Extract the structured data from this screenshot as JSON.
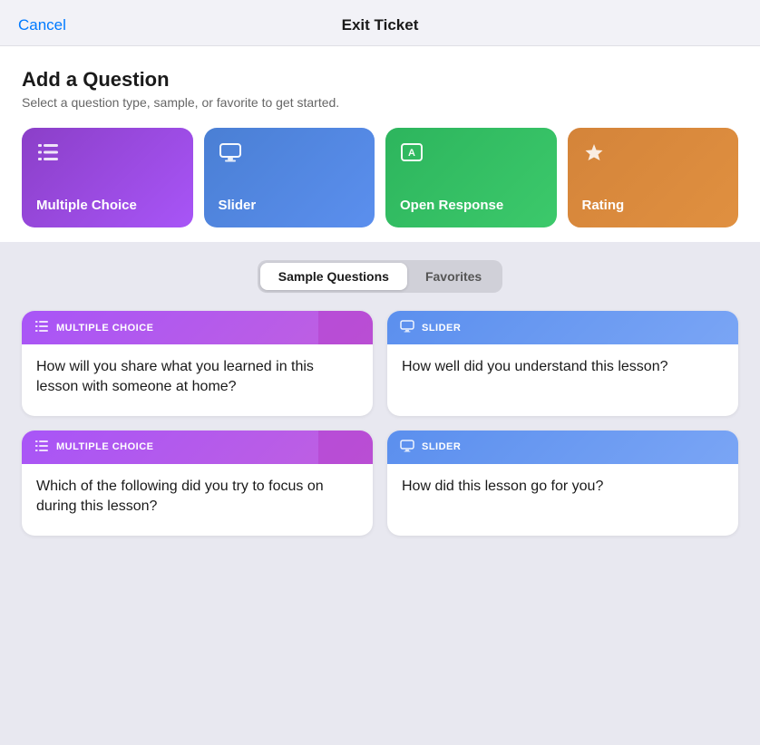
{
  "header": {
    "cancel_label": "Cancel",
    "title": "Exit Ticket"
  },
  "add_question": {
    "title": "Add a Question",
    "subtitle": "Select a question type, sample, or favorite to get started."
  },
  "type_cards": [
    {
      "id": "multiple-choice",
      "label": "Multiple Choice",
      "color": "purple",
      "icon": "list-icon"
    },
    {
      "id": "slider",
      "label": "Slider",
      "color": "blue",
      "icon": "monitor-icon"
    },
    {
      "id": "open-response",
      "label": "Open Response",
      "color": "green",
      "icon": "textbox-icon"
    },
    {
      "id": "rating",
      "label": "Rating",
      "color": "orange",
      "icon": "star-icon"
    }
  ],
  "tabs": [
    {
      "id": "sample",
      "label": "Sample Questions",
      "active": true
    },
    {
      "id": "favorites",
      "label": "Favorites",
      "active": false
    }
  ],
  "question_cards": [
    {
      "id": "q1",
      "type": "mc",
      "type_label": "MULTIPLE CHOICE",
      "question": "How will you share what you learned in this lesson with someone at home?"
    },
    {
      "id": "q2",
      "type": "sl",
      "type_label": "SLIDER",
      "question": "How well did you understand this lesson?"
    },
    {
      "id": "q3",
      "type": "mc",
      "type_label": "MULTIPLE CHOICE",
      "question": "Which of the following did you try to focus on during this lesson?"
    },
    {
      "id": "q4",
      "type": "sl",
      "type_label": "SLIDER",
      "question": "How did this lesson go for you?"
    }
  ]
}
